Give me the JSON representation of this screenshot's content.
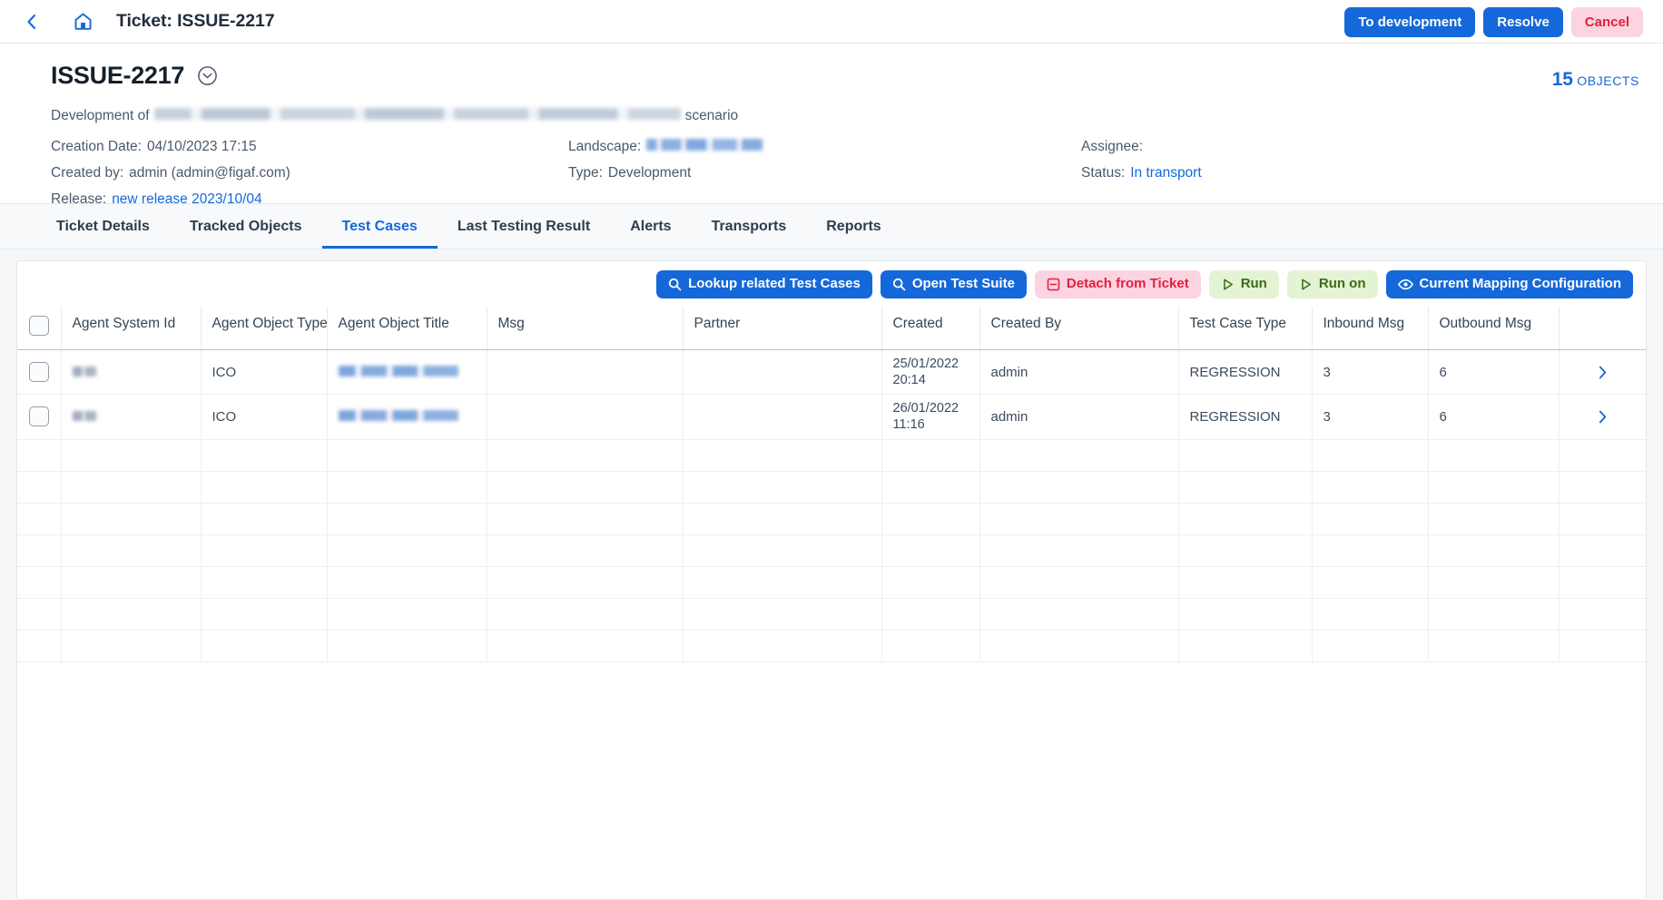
{
  "topbar": {
    "back_icon": "chevron-left-icon",
    "home_icon": "home-icon",
    "title": "Ticket: ISSUE-2217",
    "actions": [
      {
        "label": "To development",
        "style": "blue"
      },
      {
        "label": "Resolve",
        "style": "blue"
      },
      {
        "label": "Cancel",
        "style": "pink"
      }
    ]
  },
  "detail": {
    "ticket_id": "ISSUE-2217",
    "expand_icon": "chevron-down-circle-icon",
    "objects": {
      "count": "15",
      "label": "OBJECTS"
    },
    "description_prefix": "Development of",
    "description_redacted": "[redacted]",
    "description_suffix": "scenario",
    "meta": [
      {
        "label": "Creation Date:",
        "value": "04/10/2023 17:15",
        "kind": "text"
      },
      {
        "label": "Landscape:",
        "value": "[redacted]",
        "kind": "redacted-blue"
      },
      {
        "label": "Assignee:",
        "value": "",
        "kind": "text"
      },
      {
        "label": "Created by:",
        "value": "admin (admin@figaf.com)",
        "kind": "text"
      },
      {
        "label": "Type:",
        "value": "Development",
        "kind": "text"
      },
      {
        "label": "Status:",
        "value": "In transport",
        "kind": "link"
      },
      {
        "label": "Release:",
        "value": "new release 2023/10/04",
        "kind": "link"
      }
    ]
  },
  "tabs": [
    {
      "label": "Ticket Details",
      "active": false
    },
    {
      "label": "Tracked Objects",
      "active": false
    },
    {
      "label": "Test Cases",
      "active": true
    },
    {
      "label": "Last Testing Result",
      "active": false
    },
    {
      "label": "Alerts",
      "active": false
    },
    {
      "label": "Transports",
      "active": false
    },
    {
      "label": "Reports",
      "active": false
    }
  ],
  "toolbar": [
    {
      "label": "Lookup related Test Cases",
      "icon": "search-icon",
      "style": "blue"
    },
    {
      "label": "Open Test Suite",
      "icon": "search-icon",
      "style": "blue"
    },
    {
      "label": "Detach from Ticket",
      "icon": "minus-box-icon",
      "style": "pink"
    },
    {
      "label": "Run",
      "icon": "play-icon",
      "style": "green"
    },
    {
      "label": "Run on",
      "icon": "play-icon",
      "style": "green"
    },
    {
      "label": "Current Mapping Configuration",
      "icon": "eye-icon",
      "style": "blue"
    }
  ],
  "table": {
    "columns": [
      "",
      "Agent System Id",
      "Agent Object Type",
      "Agent Object Title",
      "Msg",
      "Partner",
      "Created",
      "Created By",
      "Test Case Type",
      "Inbound Msg",
      "Outbound Msg",
      ""
    ],
    "rows": [
      {
        "agent_system_id": "[redacted]",
        "agent_object_type": "ICO",
        "agent_object_title": "[redacted]",
        "msg": "",
        "partner": "",
        "created": "25/01/2022 20:14",
        "created_by": "admin",
        "test_case_type": "REGRESSION",
        "inbound_msg": "3",
        "outbound_msg": "6",
        "row_icon": "chevron-right-icon"
      },
      {
        "agent_system_id": "[redacted]",
        "agent_object_type": "ICO",
        "agent_object_title": "[redacted]",
        "msg": "",
        "partner": "",
        "created": "26/01/2022 11:16",
        "created_by": "admin",
        "test_case_type": "REGRESSION",
        "inbound_msg": "3",
        "outbound_msg": "6",
        "row_icon": "chevron-right-icon"
      }
    ],
    "empty_row_count": 7
  },
  "colors": {
    "accent_blue": "#1568d9",
    "danger_pink_bg": "#fcd3e1",
    "danger_red_text": "#e0203f",
    "green_bg": "#e4f3d3",
    "green_text": "#3a6b18",
    "page_bg": "#f4f6f8"
  }
}
